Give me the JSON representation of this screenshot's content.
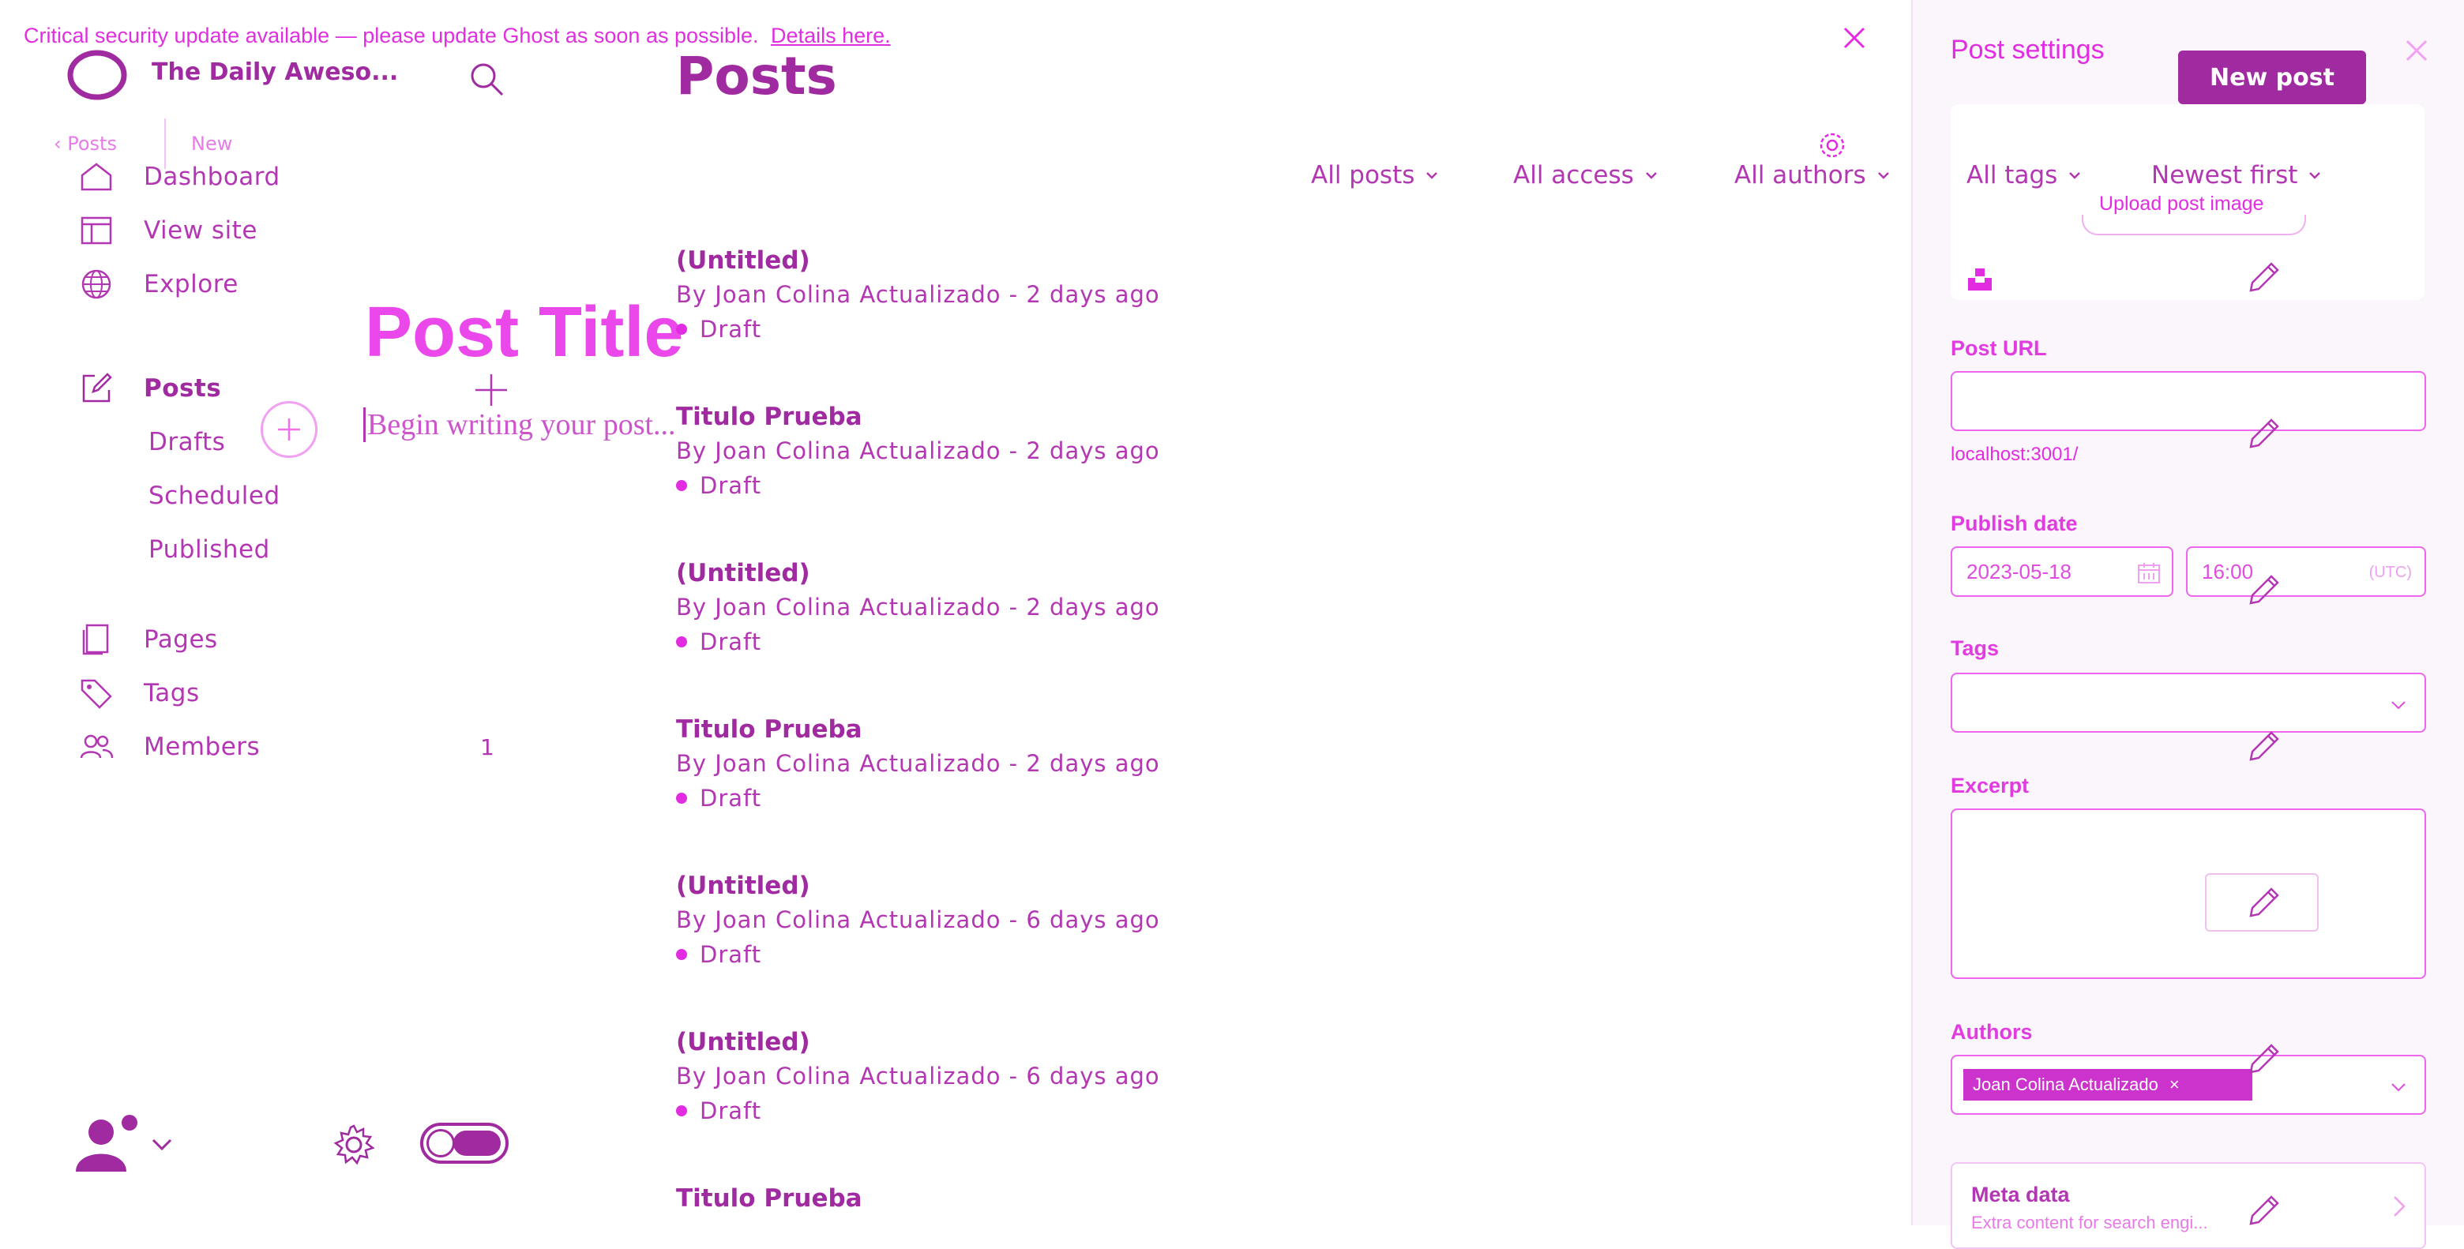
{
  "banner": {
    "text": "Critical security update available — please update Ghost as soon as possible.",
    "link": "Details here."
  },
  "site": {
    "title": "The Daily Aweso..."
  },
  "breadcrumb": {
    "parent": "Posts",
    "current": "New"
  },
  "sidebar": {
    "items": [
      {
        "label": "Dashboard",
        "icon": "home-icon"
      },
      {
        "label": "View site",
        "icon": "view-site-icon"
      },
      {
        "label": "Explore",
        "icon": "globe-icon"
      },
      {
        "label": "Posts",
        "icon": "edit-icon"
      },
      {
        "label": "Pages",
        "icon": "pages-icon"
      },
      {
        "label": "Tags",
        "icon": "tag-icon"
      },
      {
        "label": "Members",
        "icon": "members-icon"
      }
    ],
    "sub_items": [
      "Drafts",
      "Scheduled",
      "Published"
    ],
    "members_count": "1"
  },
  "editor": {
    "title_placeholder": "Post Title",
    "body_placeholder": "Begin writing your post..."
  },
  "posts_page": {
    "title": "Posts",
    "filters": [
      "All posts",
      "All access",
      "All authors",
      "All tags",
      "Newest first"
    ],
    "posts": [
      {
        "title": "(Untitled)",
        "meta": "By Joan Colina Actualizado - 2 days ago",
        "status": "Draft"
      },
      {
        "title": "Titulo Prueba",
        "meta": "By Joan Colina Actualizado - 2 days ago",
        "status": "Draft"
      },
      {
        "title": "(Untitled)",
        "meta": "By Joan Colina Actualizado - 2 days ago",
        "status": "Draft"
      },
      {
        "title": "Titulo Prueba",
        "meta": "By Joan Colina Actualizado - 2 days ago",
        "status": "Draft"
      },
      {
        "title": "(Untitled)",
        "meta": "By Joan Colina Actualizado - 6 days ago",
        "status": "Draft"
      },
      {
        "title": "(Untitled)",
        "meta": "By Joan Colina Actualizado - 6 days ago",
        "status": "Draft"
      },
      {
        "title": "Titulo Prueba",
        "meta": "",
        "status": ""
      }
    ]
  },
  "new_post_button": "New post",
  "settings": {
    "title": "Post settings",
    "upload_image": "Upload post image",
    "url_label": "Post URL",
    "url_help": "localhost:3001/",
    "publish_label": "Publish date",
    "date": "2023-05-18",
    "time": "16:00",
    "timezone": "(UTC)",
    "tags_label": "Tags",
    "excerpt_label": "Excerpt",
    "authors_label": "Authors",
    "author": "Joan Colina Actualizado",
    "meta_title": "Meta data",
    "meta_desc": "Extra content for search engi..."
  },
  "colors": {
    "accent": "#e22ce2",
    "dark": "#a02aa0"
  }
}
